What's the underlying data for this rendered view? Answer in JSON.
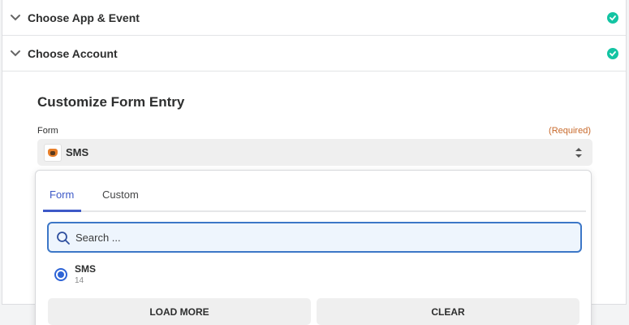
{
  "steps": [
    {
      "title": "Choose App & Event",
      "status": "complete"
    },
    {
      "title": "Choose Account",
      "status": "complete"
    }
  ],
  "colors": {
    "accent": "#3d59c7",
    "success": "#13c4a3",
    "required": "#c86a2c"
  },
  "customize": {
    "title": "Customize Form Entry",
    "field_label": "Form",
    "required_label": "(Required)",
    "selected_value": "SMS",
    "selected_icon": "app-logo-icon"
  },
  "dropdown": {
    "tabs": [
      {
        "label": "Form",
        "active": true
      },
      {
        "label": "Custom",
        "active": false
      }
    ],
    "search_placeholder": "Search ...",
    "options": [
      {
        "label": "SMS",
        "count": "14",
        "selected": true
      }
    ],
    "load_more_label": "LOAD MORE",
    "clear_label": "CLEAR"
  }
}
